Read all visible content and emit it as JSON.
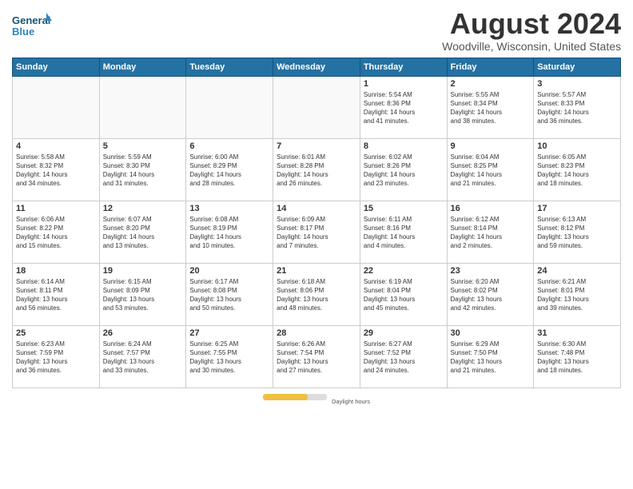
{
  "header": {
    "logo_line1": "General",
    "logo_line2": "Blue",
    "month_title": "August 2024",
    "location": "Woodville, Wisconsin, United States"
  },
  "weekdays": [
    "Sunday",
    "Monday",
    "Tuesday",
    "Wednesday",
    "Thursday",
    "Friday",
    "Saturday"
  ],
  "weeks": [
    [
      {
        "day": "",
        "info": ""
      },
      {
        "day": "",
        "info": ""
      },
      {
        "day": "",
        "info": ""
      },
      {
        "day": "",
        "info": ""
      },
      {
        "day": "1",
        "info": "Sunrise: 5:54 AM\nSunset: 8:36 PM\nDaylight: 14 hours\nand 41 minutes."
      },
      {
        "day": "2",
        "info": "Sunrise: 5:55 AM\nSunset: 8:34 PM\nDaylight: 14 hours\nand 38 minutes."
      },
      {
        "day": "3",
        "info": "Sunrise: 5:57 AM\nSunset: 8:33 PM\nDaylight: 14 hours\nand 36 minutes."
      }
    ],
    [
      {
        "day": "4",
        "info": "Sunrise: 5:58 AM\nSunset: 8:32 PM\nDaylight: 14 hours\nand 34 minutes."
      },
      {
        "day": "5",
        "info": "Sunrise: 5:59 AM\nSunset: 8:30 PM\nDaylight: 14 hours\nand 31 minutes."
      },
      {
        "day": "6",
        "info": "Sunrise: 6:00 AM\nSunset: 8:29 PM\nDaylight: 14 hours\nand 28 minutes."
      },
      {
        "day": "7",
        "info": "Sunrise: 6:01 AM\nSunset: 8:28 PM\nDaylight: 14 hours\nand 26 minutes."
      },
      {
        "day": "8",
        "info": "Sunrise: 6:02 AM\nSunset: 8:26 PM\nDaylight: 14 hours\nand 23 minutes."
      },
      {
        "day": "9",
        "info": "Sunrise: 6:04 AM\nSunset: 8:25 PM\nDaylight: 14 hours\nand 21 minutes."
      },
      {
        "day": "10",
        "info": "Sunrise: 6:05 AM\nSunset: 8:23 PM\nDaylight: 14 hours\nand 18 minutes."
      }
    ],
    [
      {
        "day": "11",
        "info": "Sunrise: 6:06 AM\nSunset: 8:22 PM\nDaylight: 14 hours\nand 15 minutes."
      },
      {
        "day": "12",
        "info": "Sunrise: 6:07 AM\nSunset: 8:20 PM\nDaylight: 14 hours\nand 13 minutes."
      },
      {
        "day": "13",
        "info": "Sunrise: 6:08 AM\nSunset: 8:19 PM\nDaylight: 14 hours\nand 10 minutes."
      },
      {
        "day": "14",
        "info": "Sunrise: 6:09 AM\nSunset: 8:17 PM\nDaylight: 14 hours\nand 7 minutes."
      },
      {
        "day": "15",
        "info": "Sunrise: 6:11 AM\nSunset: 8:16 PM\nDaylight: 14 hours\nand 4 minutes."
      },
      {
        "day": "16",
        "info": "Sunrise: 6:12 AM\nSunset: 8:14 PM\nDaylight: 14 hours\nand 2 minutes."
      },
      {
        "day": "17",
        "info": "Sunrise: 6:13 AM\nSunset: 8:12 PM\nDaylight: 13 hours\nand 59 minutes."
      }
    ],
    [
      {
        "day": "18",
        "info": "Sunrise: 6:14 AM\nSunset: 8:11 PM\nDaylight: 13 hours\nand 56 minutes."
      },
      {
        "day": "19",
        "info": "Sunrise: 6:15 AM\nSunset: 8:09 PM\nDaylight: 13 hours\nand 53 minutes."
      },
      {
        "day": "20",
        "info": "Sunrise: 6:17 AM\nSunset: 8:08 PM\nDaylight: 13 hours\nand 50 minutes."
      },
      {
        "day": "21",
        "info": "Sunrise: 6:18 AM\nSunset: 8:06 PM\nDaylight: 13 hours\nand 48 minutes."
      },
      {
        "day": "22",
        "info": "Sunrise: 6:19 AM\nSunset: 8:04 PM\nDaylight: 13 hours\nand 45 minutes."
      },
      {
        "day": "23",
        "info": "Sunrise: 6:20 AM\nSunset: 8:02 PM\nDaylight: 13 hours\nand 42 minutes."
      },
      {
        "day": "24",
        "info": "Sunrise: 6:21 AM\nSunset: 8:01 PM\nDaylight: 13 hours\nand 39 minutes."
      }
    ],
    [
      {
        "day": "25",
        "info": "Sunrise: 6:23 AM\nSunset: 7:59 PM\nDaylight: 13 hours\nand 36 minutes."
      },
      {
        "day": "26",
        "info": "Sunrise: 6:24 AM\nSunset: 7:57 PM\nDaylight: 13 hours\nand 33 minutes."
      },
      {
        "day": "27",
        "info": "Sunrise: 6:25 AM\nSunset: 7:55 PM\nDaylight: 13 hours\nand 30 minutes."
      },
      {
        "day": "28",
        "info": "Sunrise: 6:26 AM\nSunset: 7:54 PM\nDaylight: 13 hours\nand 27 minutes."
      },
      {
        "day": "29",
        "info": "Sunrise: 6:27 AM\nSunset: 7:52 PM\nDaylight: 13 hours\nand 24 minutes."
      },
      {
        "day": "30",
        "info": "Sunrise: 6:29 AM\nSunset: 7:50 PM\nDaylight: 13 hours\nand 21 minutes."
      },
      {
        "day": "31",
        "info": "Sunrise: 6:30 AM\nSunset: 7:48 PM\nDaylight: 13 hours\nand 18 minutes."
      }
    ]
  ],
  "footer": {
    "daylight_label": "Daylight hours"
  }
}
